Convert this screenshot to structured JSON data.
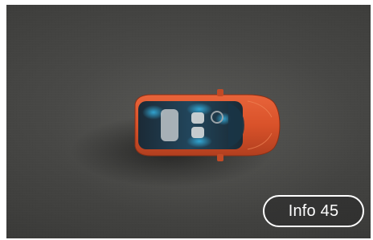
{
  "hero": {
    "image_subject": "red-suv-top-view",
    "car_color": "#d9522a",
    "ground_color": "#4a4a48",
    "cabin_glow_color": "#35b7e8"
  },
  "info_button": {
    "label": "Info 45"
  }
}
